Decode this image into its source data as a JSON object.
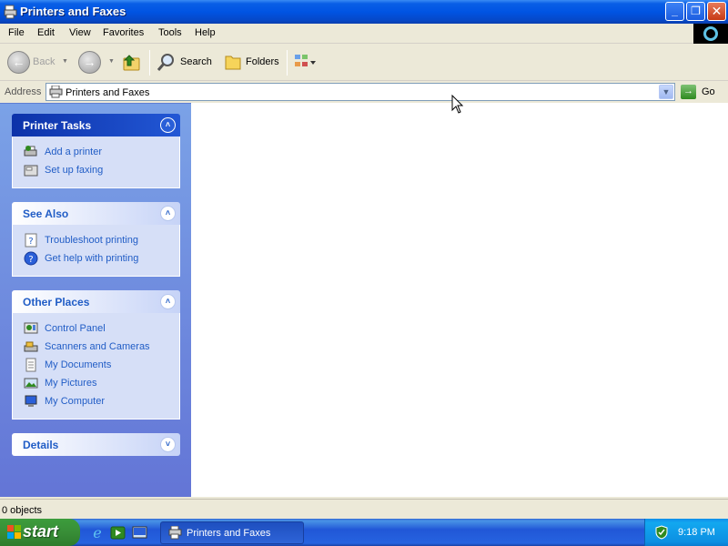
{
  "window": {
    "title": "Printers and Faxes",
    "controls": {
      "minimize": "_",
      "maximize": "❐",
      "close": "✕"
    }
  },
  "menu": {
    "items": [
      "File",
      "Edit",
      "View",
      "Favorites",
      "Tools",
      "Help"
    ]
  },
  "toolbar": {
    "back_label": "Back",
    "search_label": "Search",
    "folders_label": "Folders",
    "icons": [
      "back-icon",
      "forward-icon",
      "up-folder-icon",
      "search-icon",
      "folders-icon",
      "views-icon"
    ]
  },
  "address": {
    "label": "Address",
    "value": "Printers and Faxes",
    "go_label": "Go"
  },
  "left_pane": {
    "printer_tasks": {
      "title": "Printer Tasks",
      "items": [
        {
          "label": "Add a printer",
          "icon": "add-printer-icon"
        },
        {
          "label": "Set up faxing",
          "icon": "fax-icon"
        }
      ]
    },
    "see_also": {
      "title": "See Also",
      "items": [
        {
          "label": "Troubleshoot printing",
          "icon": "help-page-icon"
        },
        {
          "label": "Get help with printing",
          "icon": "help-circle-icon"
        }
      ]
    },
    "other_places": {
      "title": "Other Places",
      "items": [
        {
          "label": "Control Panel",
          "icon": "control-panel-icon"
        },
        {
          "label": "Scanners and Cameras",
          "icon": "scanner-icon"
        },
        {
          "label": "My Documents",
          "icon": "documents-icon"
        },
        {
          "label": "My Pictures",
          "icon": "pictures-icon"
        },
        {
          "label": "My Computer",
          "icon": "computer-icon"
        }
      ]
    },
    "details": {
      "title": "Details"
    }
  },
  "status": {
    "text": "0 objects"
  },
  "taskbar": {
    "start_label": "start",
    "task_button": "Printers and Faxes",
    "clock": "9:18 PM"
  },
  "colors": {
    "titlebar": "#0054e3",
    "link": "#215dc6",
    "task_pane": "#6375d6",
    "start_green": "#388e37"
  }
}
